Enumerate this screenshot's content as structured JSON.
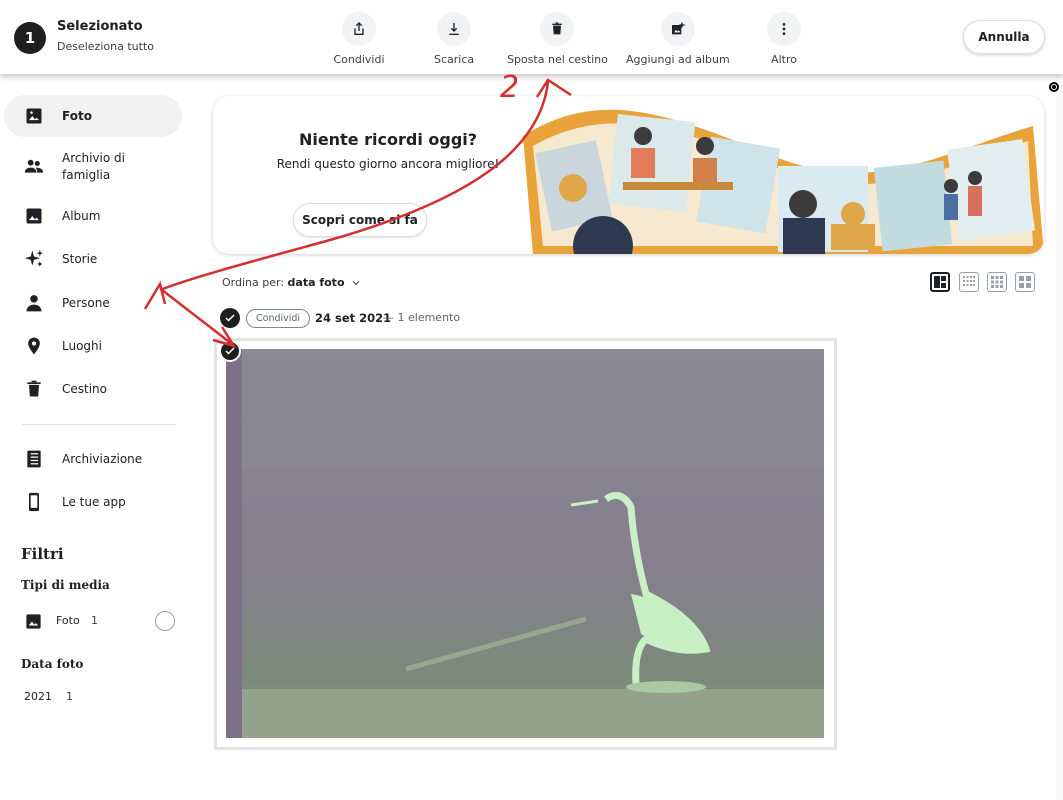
{
  "topbar": {
    "selected_count": "1",
    "selected_title": "Selezionato",
    "deselect_all": "Deseleziona tutto",
    "actions": [
      {
        "label": "Condividi",
        "icon": "share-icon"
      },
      {
        "label": "Scarica",
        "icon": "download-icon"
      },
      {
        "label": "Sposta nel cestino",
        "icon": "trash-icon"
      },
      {
        "label": "Aggiungi ad album",
        "icon": "add-to-album-icon"
      },
      {
        "label": "Altro",
        "icon": "more-vert-icon"
      }
    ],
    "cancel_label": "Annulla"
  },
  "sidebar": {
    "items": [
      {
        "label": "Foto",
        "icon": "photo-icon",
        "active": true
      },
      {
        "label": "Archivio di famiglia",
        "icon": "people-icon"
      },
      {
        "label": "Album",
        "icon": "album-icon"
      },
      {
        "label": "Storie",
        "icon": "sparkle-icon"
      },
      {
        "label": "Persone",
        "icon": "person-icon"
      },
      {
        "label": "Luoghi",
        "icon": "location-pin-icon"
      },
      {
        "label": "Cestino",
        "icon": "trash-icon"
      },
      {
        "label": "Archiviazione",
        "icon": "storage-icon"
      },
      {
        "label": "Le tue app",
        "icon": "phone-icon"
      }
    ],
    "filters_title": "Filtri",
    "media_types_title": "Tipi di media",
    "media_filter": {
      "label": "Foto",
      "count": "1"
    },
    "date_title": "Data foto",
    "year_filter": {
      "label": "2021",
      "count": "1"
    }
  },
  "banner": {
    "title": "Niente ricordi oggi?",
    "text": "Rendi questo giorno ancora migliore!",
    "button": "Scopri come si fa"
  },
  "sort": {
    "prefix": "Ordina per:",
    "value": "data foto"
  },
  "group": {
    "share_chip": "Condividi",
    "date": "24 set 2021",
    "count": "— 1 elemento"
  },
  "annotation": {
    "number": "2",
    "color": "#d32f2f"
  },
  "colors": {
    "accent_dark": "#1f1f1f",
    "annotation_red": "#d32f2f",
    "banner_film": "#e8a33a"
  }
}
